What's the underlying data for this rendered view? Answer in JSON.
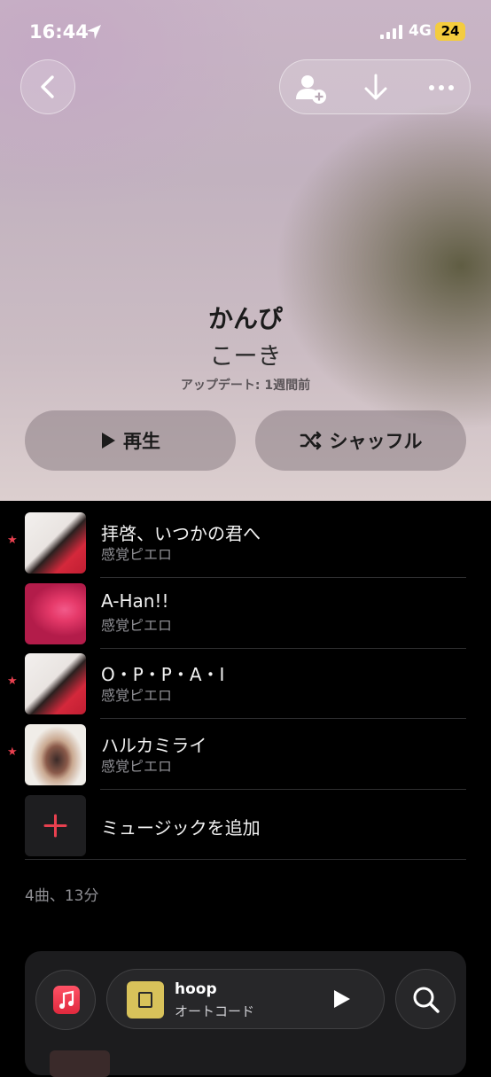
{
  "status_bar": {
    "time": "16:44",
    "network": "4G",
    "battery": "24"
  },
  "header": {
    "back_icon": "chevron-left-icon",
    "actions": [
      "add-person-icon",
      "download-icon",
      "more-icon"
    ]
  },
  "playlist": {
    "title": "かんぴ",
    "owner": "こーき",
    "updated": "アップデート: 1週間前",
    "play_label": "再生",
    "shuffle_label": "シャッフル"
  },
  "tracks": [
    {
      "title": "拝啓、いつかの君へ",
      "artist": "感覚ピエロ",
      "favorite": true
    },
    {
      "title": "A-Han!!",
      "artist": "感覚ピエロ",
      "favorite": false
    },
    {
      "title": "O・P・P・A・I",
      "artist": "感覚ピエロ",
      "favorite": true
    },
    {
      "title": "ハルカミライ",
      "artist": "感覚ピエロ",
      "favorite": true
    }
  ],
  "add_music_label": "ミュージックを追加",
  "summary": "4曲、13分",
  "mini_player": {
    "song": "hoop",
    "artist": "オートコード"
  },
  "colors": {
    "accent": "#e8404f",
    "background": "#000000"
  }
}
